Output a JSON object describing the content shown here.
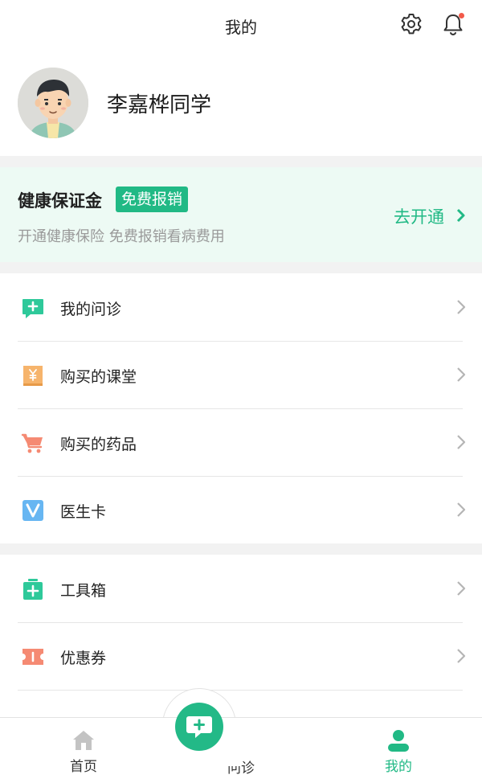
{
  "header": {
    "title": "我的"
  },
  "profile": {
    "name": "李嘉桦同学"
  },
  "banner": {
    "title": "健康保证金",
    "badge": "免费报销",
    "subtitle": "开通健康保险 免费报销看病费用",
    "action": "去开通"
  },
  "menu_group_1": [
    {
      "label": "我的问诊",
      "icon": "chat-plus-icon"
    },
    {
      "label": "购买的课堂",
      "icon": "book-yen-icon"
    },
    {
      "label": "购买的药品",
      "icon": "cart-icon"
    },
    {
      "label": "医生卡",
      "icon": "v-card-icon"
    }
  ],
  "menu_group_2": [
    {
      "label": "工具箱",
      "icon": "toolbox-icon"
    },
    {
      "label": "优惠券",
      "icon": "coupon-icon"
    }
  ],
  "tabbar": {
    "home": "首页",
    "consult": "问诊",
    "mine": "我的"
  },
  "colors": {
    "accent": "#21b985",
    "banner_bg": "#edfaf4",
    "notification_dot": "#f25a4a"
  }
}
